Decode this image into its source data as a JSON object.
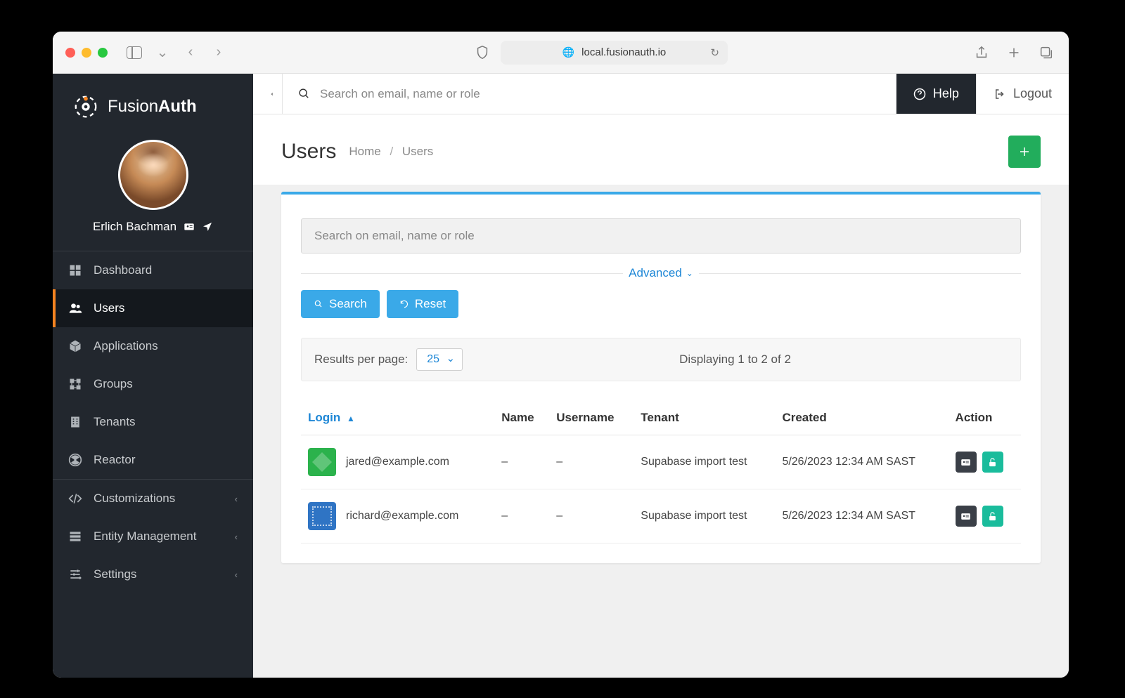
{
  "browser": {
    "address": "local.fusionauth.io"
  },
  "brand": {
    "name_light": "Fusion",
    "name_bold": "Auth"
  },
  "profile": {
    "name": "Erlich Bachman"
  },
  "nav": {
    "items": [
      {
        "label": "Dashboard",
        "icon": "dashboard"
      },
      {
        "label": "Users",
        "icon": "users"
      },
      {
        "label": "Applications",
        "icon": "applications"
      },
      {
        "label": "Groups",
        "icon": "groups"
      },
      {
        "label": "Tenants",
        "icon": "tenants"
      },
      {
        "label": "Reactor",
        "icon": "reactor"
      }
    ],
    "sub": [
      {
        "label": "Customizations",
        "icon": "code"
      },
      {
        "label": "Entity Management",
        "icon": "server"
      },
      {
        "label": "Settings",
        "icon": "sliders"
      }
    ],
    "active_index": 1
  },
  "topbar": {
    "search_placeholder": "Search on email, name or role",
    "help": "Help",
    "logout": "Logout"
  },
  "page": {
    "title": "Users",
    "breadcrumb_home": "Home",
    "breadcrumb_current": "Users"
  },
  "panel": {
    "search_placeholder": "Search on email, name or role",
    "advanced": "Advanced",
    "search_btn": "Search",
    "reset_btn": "Reset",
    "results_per_page_label": "Results per page:",
    "results_per_page_value": "25",
    "displaying": "Displaying 1 to 2 of 2"
  },
  "table": {
    "headers": {
      "login": "Login",
      "name": "Name",
      "username": "Username",
      "tenant": "Tenant",
      "created": "Created",
      "action": "Action"
    },
    "rows": [
      {
        "login": "jared@example.com",
        "name": "–",
        "username": "–",
        "tenant": "Supabase import test",
        "created": "5/26/2023 12:34 AM SAST",
        "avatar": "green"
      },
      {
        "login": "richard@example.com",
        "name": "–",
        "username": "–",
        "tenant": "Supabase import test",
        "created": "5/26/2023 12:34 AM SAST",
        "avatar": "blue"
      }
    ]
  }
}
